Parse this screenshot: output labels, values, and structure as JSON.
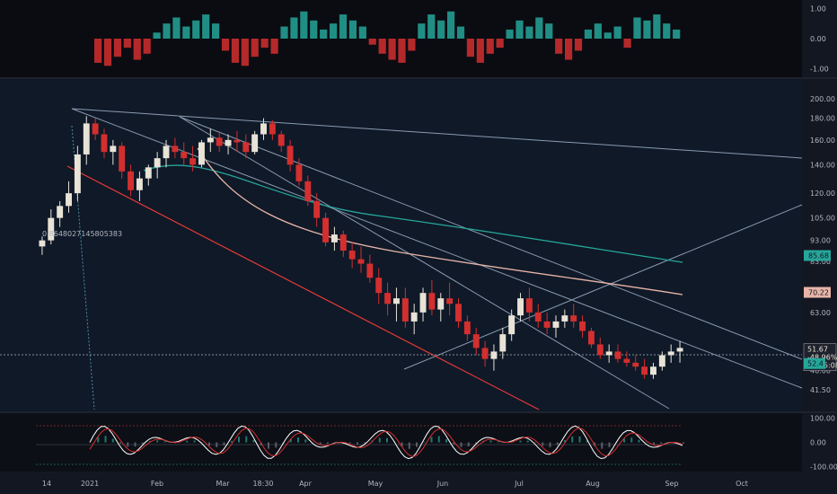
{
  "chart_data": {
    "type": "candlestick",
    "main": {
      "price_axis_ticks": [
        "200.00",
        "180.00",
        "160.00",
        "140.00",
        "120.00",
        "105.00",
        "93.00",
        "83.00",
        "70.22",
        "63.00",
        "51.67",
        "46.00",
        "41.50"
      ],
      "yscale": "log",
      "ylim": [
        38,
        215
      ],
      "annotation": "0.8648027145805383",
      "highlighted_values": [
        {
          "value": "85.68",
          "color": "#26a69a"
        },
        {
          "value": "70.22",
          "color": "#e8b4a8"
        }
      ],
      "last_price_box": [
        "51.67",
        "-48.96%",
        "01:55:08"
      ],
      "extra_tag": "52.4",
      "bars": [
        [
          90,
          95,
          86,
          93
        ],
        [
          93,
          110,
          91,
          105
        ],
        [
          105,
          115,
          100,
          112
        ],
        [
          112,
          128,
          108,
          120
        ],
        [
          120,
          155,
          115,
          148
        ],
        [
          148,
          182,
          140,
          175
        ],
        [
          175,
          180,
          160,
          165
        ],
        [
          165,
          170,
          145,
          150
        ],
        [
          150,
          160,
          140,
          155
        ],
        [
          155,
          158,
          130,
          135
        ],
        [
          135,
          140,
          118,
          122
        ],
        [
          122,
          135,
          115,
          130
        ],
        [
          130,
          140,
          125,
          138
        ],
        [
          138,
          150,
          130,
          145
        ],
        [
          145,
          160,
          138,
          155
        ],
        [
          155,
          162,
          145,
          150
        ],
        [
          150,
          158,
          140,
          145
        ],
        [
          145,
          155,
          135,
          140
        ],
        [
          140,
          160,
          138,
          158
        ],
        [
          158,
          170,
          150,
          162
        ],
        [
          162,
          168,
          150,
          155
        ],
        [
          155,
          165,
          148,
          160
        ],
        [
          160,
          168,
          150,
          158
        ],
        [
          158,
          165,
          145,
          150
        ],
        [
          150,
          168,
          148,
          165
        ],
        [
          165,
          180,
          160,
          175
        ],
        [
          175,
          178,
          160,
          165
        ],
        [
          165,
          168,
          150,
          155
        ],
        [
          155,
          160,
          135,
          140
        ],
        [
          140,
          145,
          125,
          128
        ],
        [
          128,
          132,
          112,
          115
        ],
        [
          115,
          120,
          100,
          105
        ],
        [
          105,
          108,
          90,
          92
        ],
        [
          92,
          100,
          88,
          96
        ],
        [
          96,
          98,
          85,
          88
        ],
        [
          88,
          92,
          80,
          84
        ],
        [
          84,
          90,
          78,
          82
        ],
        [
          82,
          86,
          74,
          76
        ],
        [
          76,
          80,
          66,
          70
        ],
        [
          70,
          74,
          62,
          66
        ],
        [
          66,
          72,
          60,
          68
        ],
        [
          68,
          72,
          58,
          60
        ],
        [
          60,
          66,
          56,
          63
        ],
        [
          63,
          72,
          60,
          70
        ],
        [
          70,
          75,
          62,
          64
        ],
        [
          64,
          70,
          60,
          68
        ],
        [
          68,
          74,
          62,
          66
        ],
        [
          66,
          68,
          58,
          60
        ],
        [
          60,
          62,
          54,
          56
        ],
        [
          56,
          58,
          50,
          52
        ],
        [
          52,
          54,
          47,
          49
        ],
        [
          49,
          53,
          46,
          51
        ],
        [
          51,
          58,
          49,
          56
        ],
        [
          56,
          64,
          54,
          62
        ],
        [
          62,
          70,
          60,
          68
        ],
        [
          68,
          72,
          60,
          63
        ],
        [
          63,
          66,
          58,
          60
        ],
        [
          60,
          63,
          56,
          58
        ],
        [
          58,
          62,
          55,
          60
        ],
        [
          60,
          64,
          58,
          62
        ],
        [
          62,
          66,
          58,
          60
        ],
        [
          60,
          62,
          55,
          57
        ],
        [
          57,
          58,
          52,
          53
        ],
        [
          53,
          55,
          49,
          50
        ],
        [
          50,
          53,
          48,
          51
        ],
        [
          51,
          53,
          48,
          49
        ],
        [
          49,
          51,
          47,
          48
        ],
        [
          48,
          50,
          46,
          47
        ],
        [
          47,
          49,
          44,
          45
        ],
        [
          45,
          48,
          44,
          47
        ],
        [
          47,
          51,
          46,
          50
        ],
        [
          50,
          53,
          48,
          51
        ],
        [
          51,
          54,
          48,
          52
        ]
      ]
    },
    "top_indicator": {
      "axis_ticks": [
        "1.00",
        "0.00",
        "-1.00"
      ],
      "ylim": [
        -1.1,
        1.1
      ],
      "histogram": [
        -0.8,
        -0.9,
        -0.6,
        -0.3,
        -0.7,
        -0.5,
        0.2,
        0.5,
        0.7,
        0.4,
        0.6,
        0.8,
        0.5,
        -0.4,
        -0.8,
        -0.9,
        -0.6,
        -0.3,
        -0.5,
        0.4,
        0.7,
        0.9,
        0.6,
        0.3,
        0.5,
        0.8,
        0.6,
        0.4,
        -0.2,
        -0.5,
        -0.7,
        -0.8,
        -0.4,
        0.5,
        0.8,
        0.6,
        0.9,
        0.4,
        -0.6,
        -0.8,
        -0.5,
        -0.3,
        0.3,
        0.6,
        0.4,
        0.7,
        0.5,
        -0.5,
        -0.7,
        -0.4,
        0.3,
        0.5,
        0.2,
        0.4,
        -0.3,
        0.7,
        0.6,
        0.8,
        0.5,
        0.3
      ]
    },
    "bottom_indicator": {
      "axis_ticks": [
        "100.00",
        "0.00",
        "-100.00"
      ],
      "ylim": [
        -110,
        110
      ]
    },
    "x_axis_labels": [
      "14",
      "2021",
      "Feb",
      "Mar",
      "18:30",
      "Apr",
      "May",
      "Jun",
      "Jul",
      "Aug",
      "Sep",
      "Oct"
    ],
    "colors": {
      "up": "#e8e3d6",
      "down": "#d32f2f",
      "ma_fast": "#26a69a",
      "ma_slow": "#e8b4a8",
      "trend": "#8a9bb0",
      "red_trend": "#e53935"
    }
  }
}
